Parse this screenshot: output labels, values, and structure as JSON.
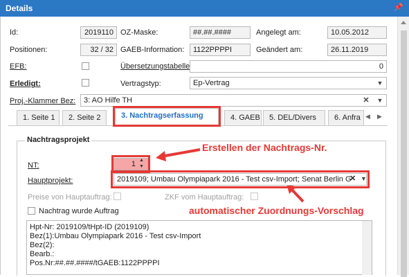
{
  "window": {
    "title": "Details",
    "pin_icon": "pin-icon"
  },
  "fields": {
    "id_label": "Id:",
    "id_value": "2019110",
    "oz_label": "OZ-Maske:",
    "oz_value": "##.##.####",
    "angelegt_label": "Angelegt am:",
    "angelegt_value": "10.05.2012",
    "positionen_label": "Positionen:",
    "positionen_value": "32 / 32",
    "gaeb_label": "GAEB-Information:",
    "gaeb_value": "1122PPPPI",
    "geaendert_label": "Geändert am:",
    "geaendert_value": "26.11.2019",
    "efb_label": "EFB:",
    "uebersetzung_label": "Übersetzungstabelle",
    "uebersetzung_value": "0",
    "erledigt_label": "Erledigt:",
    "vertragstyp_label": "Vertragstyp:",
    "vertragstyp_value": "Ep-Vertrag",
    "klammer_label": "Proj.-Klammer Bez:",
    "klammer_value": "3: AO Hilfe TH"
  },
  "tabs": [
    {
      "label": "1. Seite 1"
    },
    {
      "label": "2. Seite 2"
    },
    {
      "label": "3. Nachtragserfassung"
    },
    {
      "label": "4. GAEB"
    },
    {
      "label": "5. DEL/Divers"
    },
    {
      "label": "6. Anfra"
    }
  ],
  "nachtrag": {
    "group_title": "Nachtragsprojekt",
    "nt_label": "NT:",
    "nt_value": "1",
    "hauptprojekt_label": "Hauptprojekt:",
    "hauptprojekt_value": "2019109; Umbau Olympiapark 2016 - Test csv-Import; Senat Berlin G",
    "preise_label": "Preise von Hauptauftrag:",
    "zkf_label": "ZKF vom Hauptauftrag:",
    "nachtrag_auftrag_label": "Nachtrag wurde Auftrag",
    "memo_lines": [
      "Hpt-Nr: 2019109/tHpt-ID (2019109)",
      "Bez(1):Umbau Olympiapark 2016 - Test csv-Import",
      "Bez(2):",
      "Bearb.:",
      "Pos.Nr:##.##.####/tGAEB:1122PPPPI"
    ]
  },
  "annotations": {
    "nt_note": "Erstellen der Nachtrags-Nr.",
    "haupt_note": "automatischer Zuordnungs-Vorschlag",
    "color": "#e53935"
  },
  "colors": {
    "titlebar": "#2b78c5",
    "active_tab": "#1f6fc5",
    "highlight_red": "#e53935"
  }
}
